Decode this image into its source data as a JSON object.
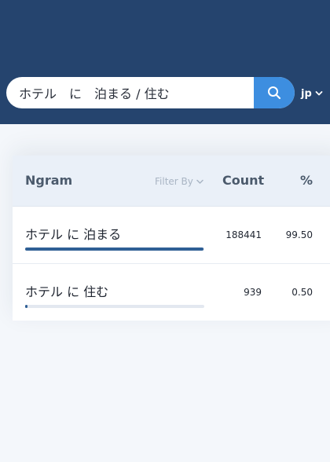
{
  "search": {
    "value": "ホテル　に　泊まる / 住む"
  },
  "language": {
    "selected": "jp"
  },
  "table": {
    "headers": {
      "ngram": "Ngram",
      "filter": "Filter By",
      "count": "Count",
      "percent": "%"
    },
    "rows": [
      {
        "ngram": "ホテル に 泊まる",
        "count": "188441",
        "percent": "99.50",
        "share": 0.995
      },
      {
        "ngram": "ホテル に 住む",
        "count": "939",
        "percent": "0.50",
        "share": 0.005
      }
    ]
  },
  "colors": {
    "header_bg": "#25446e",
    "accent": "#3d8ee0",
    "bar": "#2f5f95"
  },
  "icons": {
    "search": "search-icon",
    "lang_chevron": "chevron-down-icon",
    "filter_chevron": "chevron-down-icon"
  }
}
